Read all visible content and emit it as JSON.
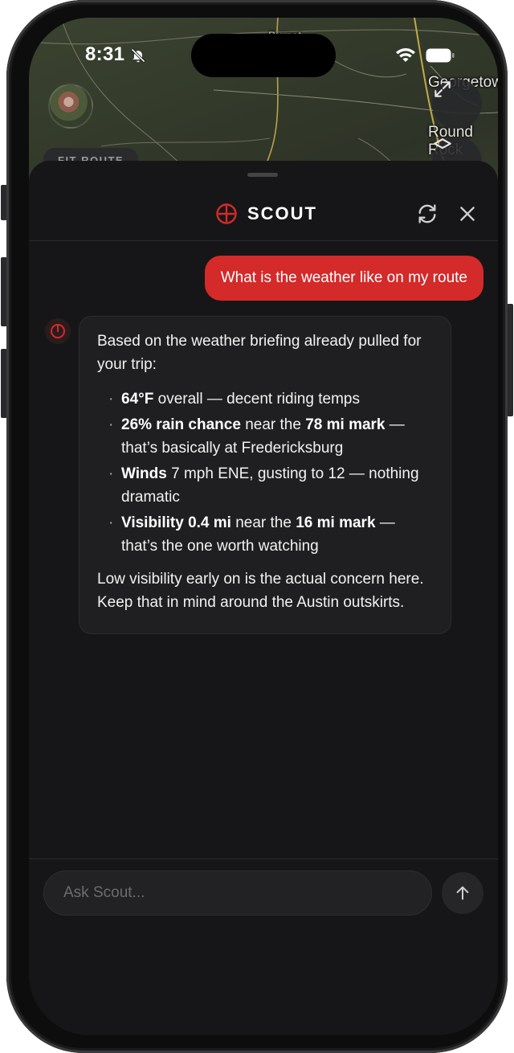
{
  "status_bar": {
    "time": "8:31"
  },
  "map": {
    "labels": {
      "top": "Burnet",
      "georgetown": "Georgetown",
      "round_rock": "Round Rock"
    },
    "fit_route_label": "FIT ROUTE"
  },
  "scout": {
    "title": "SCOUT",
    "accent_color": "#d42a2a"
  },
  "messages": {
    "user": "What is the weather like on my route",
    "bot": {
      "intro": "Based on the weather briefing already pulled for your trip:",
      "bullets": [
        {
          "b1": "64°F",
          "t1": " overall — decent riding temps"
        },
        {
          "b1": "26% rain chance",
          "t1": " near the ",
          "b2": "78 mi mark",
          "t2": " — that’s basically at Fredericksburg"
        },
        {
          "b1": "Winds",
          "t1": " 7 mph ENE, gusting to 12 — nothing dramatic"
        },
        {
          "b1": "Visibility 0.4 mi",
          "t1": " near the ",
          "b2": "16 mi mark",
          "t2": " — that’s the one worth watching"
        }
      ],
      "outro": "Low visibility early on is the actual concern here. Keep that in mind around the Austin outskirts."
    }
  },
  "composer": {
    "placeholder": "Ask Scout..."
  }
}
